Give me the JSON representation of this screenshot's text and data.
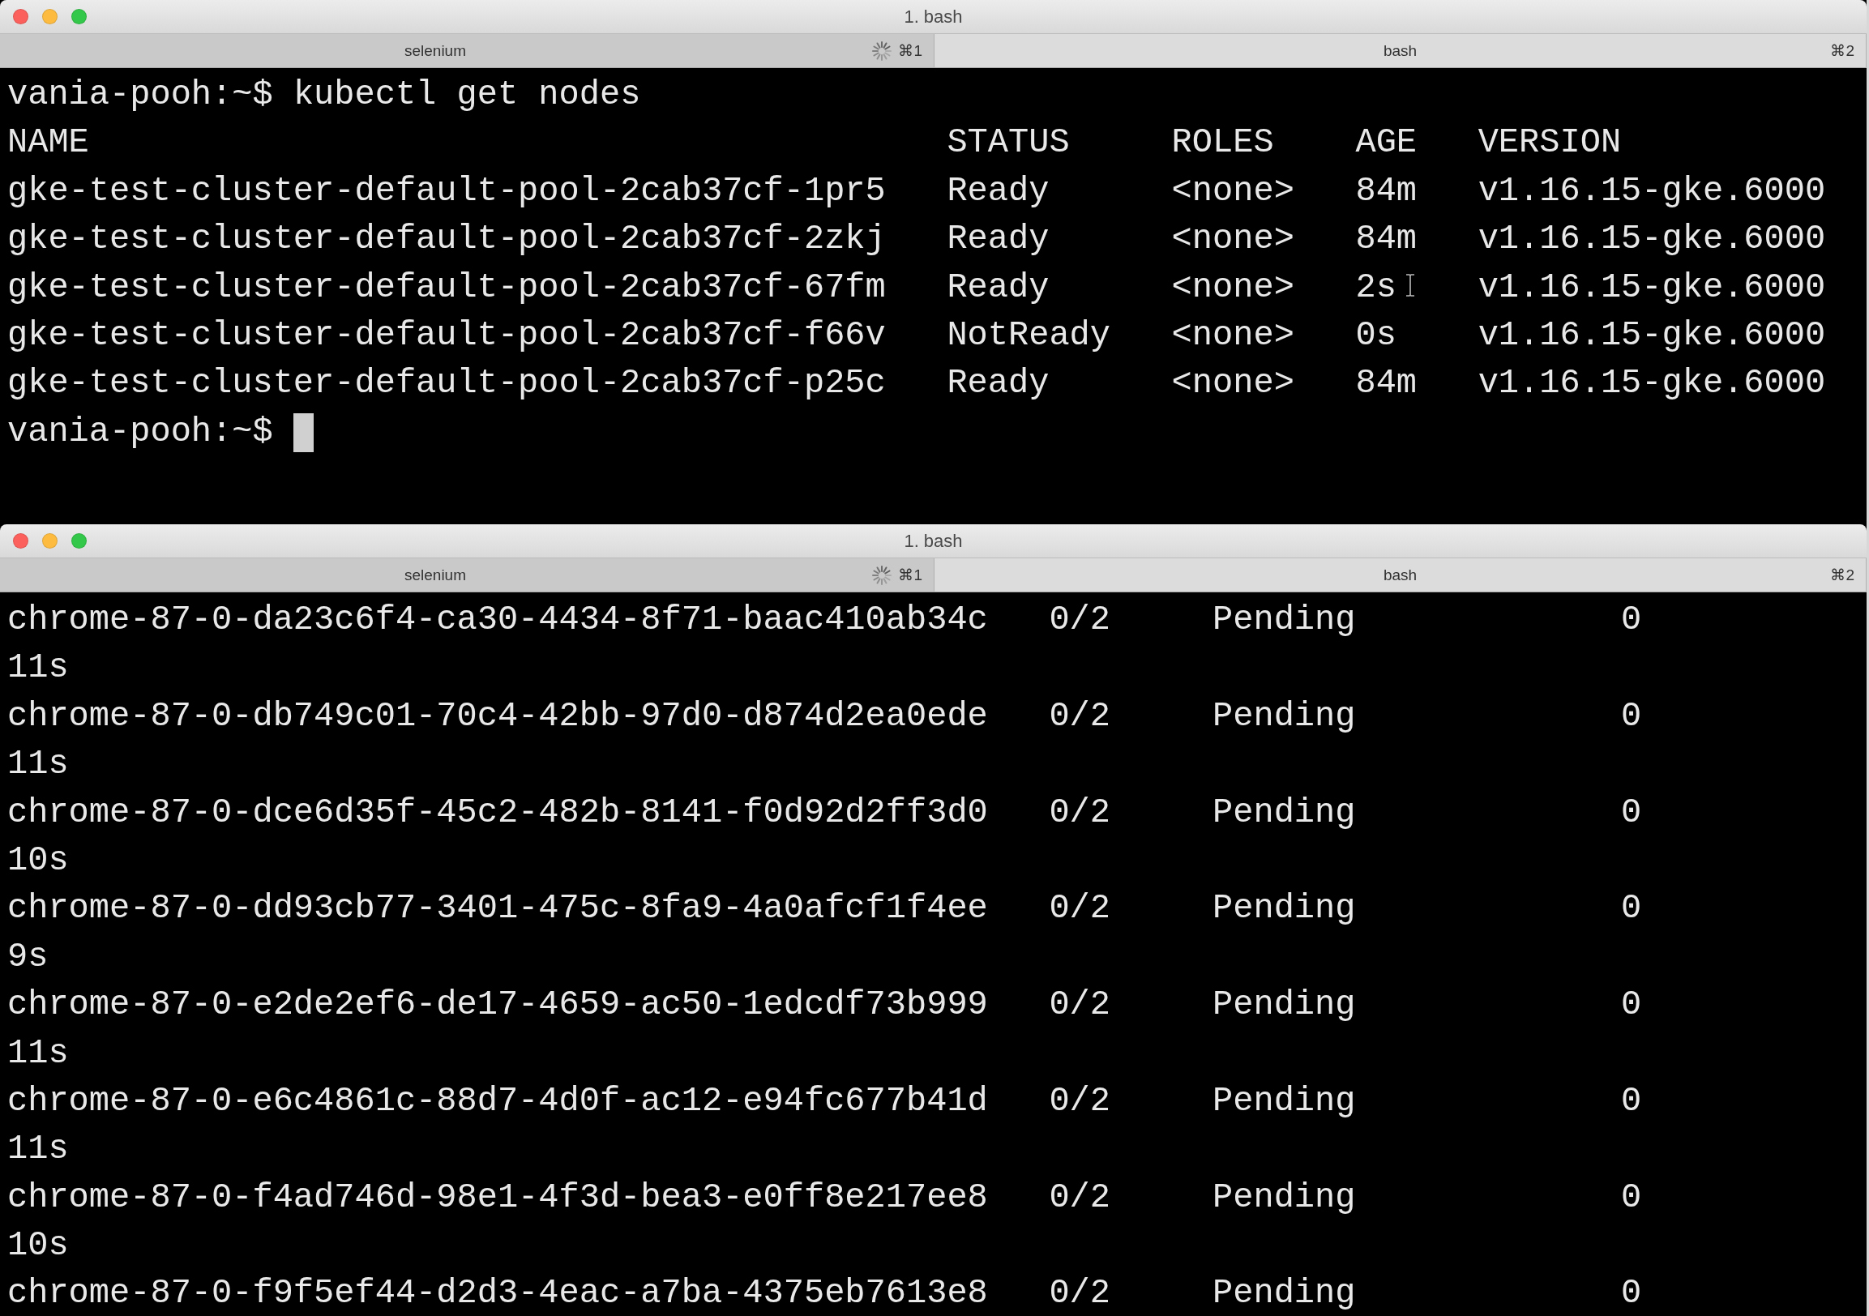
{
  "windows": [
    {
      "title": "1. bash",
      "kind": "nodes",
      "tabs": [
        {
          "label": "selenium",
          "shortcut": "⌘1",
          "busy": true,
          "selected": false
        },
        {
          "label": "bash",
          "shortcut": "⌘2",
          "busy": false,
          "selected": true
        }
      ],
      "lines": [
        {
          "kind": "prompt",
          "prompt": "vania-pooh:~$",
          "command": "kubectl get nodes",
          "cursor": false
        },
        {
          "kind": "row",
          "cells": [
            "NAME",
            "STATUS",
            "ROLES",
            "AGE",
            "VERSION"
          ]
        },
        {
          "kind": "row",
          "cells": [
            "gke-test-cluster-default-pool-2cab37cf-1pr5",
            "Ready",
            "<none>",
            "84m",
            "v1.16.15-gke.6000"
          ]
        },
        {
          "kind": "row",
          "cells": [
            "gke-test-cluster-default-pool-2cab37cf-2zkj",
            "Ready",
            "<none>",
            "84m",
            "v1.16.15-gke.6000"
          ]
        },
        {
          "kind": "row",
          "cells": [
            "gke-test-cluster-default-pool-2cab37cf-67fm",
            "Ready",
            "<none>",
            "2s",
            "v1.16.15-gke.6000"
          ],
          "pointer": true
        },
        {
          "kind": "row",
          "cells": [
            "gke-test-cluster-default-pool-2cab37cf-f66v",
            "NotReady",
            "<none>",
            "0s",
            "v1.16.15-gke.6000"
          ]
        },
        {
          "kind": "row",
          "cells": [
            "gke-test-cluster-default-pool-2cab37cf-p25c",
            "Ready",
            "<none>",
            "84m",
            "v1.16.15-gke.6000"
          ]
        },
        {
          "kind": "prompt",
          "prompt": "vania-pooh:~$",
          "cursor": true
        }
      ]
    },
    {
      "title": "1. bash",
      "kind": "pods",
      "tabs": [
        {
          "label": "selenium",
          "shortcut": "⌘1",
          "busy": true,
          "selected": false
        },
        {
          "label": "bash",
          "shortcut": "⌘2",
          "busy": false,
          "selected": true
        }
      ],
      "lines": [
        {
          "kind": "row",
          "cells": [
            "chrome-87-0-da23c6f4-ca30-4434-8f71-baac410ab34c",
            "0/2",
            "Pending",
            "0"
          ]
        },
        {
          "kind": "wrap",
          "text": "11s"
        },
        {
          "kind": "row",
          "cells": [
            "chrome-87-0-db749c01-70c4-42bb-97d0-d874d2ea0ede",
            "0/2",
            "Pending",
            "0"
          ]
        },
        {
          "kind": "wrap",
          "text": "11s"
        },
        {
          "kind": "row",
          "cells": [
            "chrome-87-0-dce6d35f-45c2-482b-8141-f0d92d2ff3d0",
            "0/2",
            "Pending",
            "0"
          ]
        },
        {
          "kind": "wrap",
          "text": "10s"
        },
        {
          "kind": "row",
          "cells": [
            "chrome-87-0-dd93cb77-3401-475c-8fa9-4a0afcf1f4ee",
            "0/2",
            "Pending",
            "0"
          ]
        },
        {
          "kind": "wrap",
          "text": "9s"
        },
        {
          "kind": "row",
          "cells": [
            "chrome-87-0-e2de2ef6-de17-4659-ac50-1edcdf73b999",
            "0/2",
            "Pending",
            "0"
          ]
        },
        {
          "kind": "wrap",
          "text": "11s"
        },
        {
          "kind": "row",
          "cells": [
            "chrome-87-0-e6c4861c-88d7-4d0f-ac12-e94fc677b41d",
            "0/2",
            "Pending",
            "0"
          ]
        },
        {
          "kind": "wrap",
          "text": "11s"
        },
        {
          "kind": "row",
          "cells": [
            "chrome-87-0-f4ad746d-98e1-4f3d-bea3-e0ff8e217ee8",
            "0/2",
            "Pending",
            "0"
          ]
        },
        {
          "kind": "wrap",
          "text": "10s"
        },
        {
          "kind": "row",
          "cells": [
            "chrome-87-0-f9f5ef44-d2d3-4eac-a7ba-4375eb7613e8",
            "0/2",
            "Pending",
            "0"
          ]
        }
      ]
    }
  ]
}
